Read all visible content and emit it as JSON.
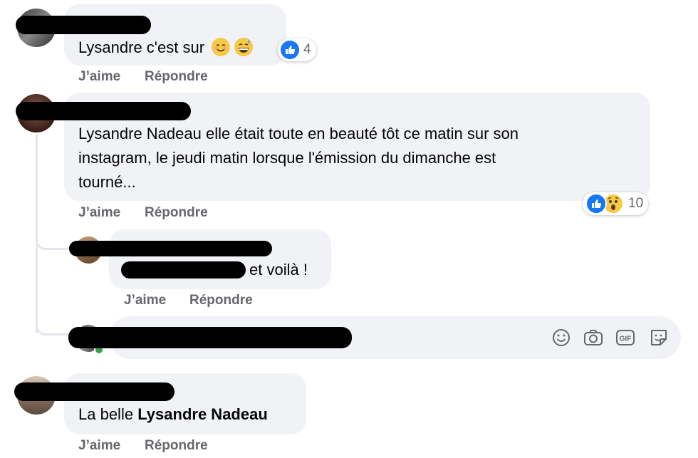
{
  "comments": [
    {
      "text": "Lysandre c'est sur",
      "reaction_count": "4",
      "like_label": "J’aime",
      "reply_label": "Répondre"
    },
    {
      "text_lines": [
        "Lysandre Nadeau elle était toute en beauté tôt ce matin sur son",
        "instagram, le jeudi matin lorsque l'émission du dimanche est",
        "tourné..."
      ],
      "reaction_count": "10",
      "like_label": "J’aime",
      "reply_label": "Répondre"
    },
    {
      "text": "et voilà !",
      "like_label": "J’aime",
      "reply_label": "Répondre"
    },
    {
      "text_prefix": "La belle ",
      "text_bold": "Lysandre Nadeau",
      "like_label": "J’aime",
      "reply_label": "Répondre"
    }
  ],
  "composer": {
    "icons": [
      "emoji-icon",
      "camera-icon",
      "gif-icon",
      "sticker-icon"
    ]
  },
  "colors": {
    "like_blue": "#1877f2",
    "bubble": "#f0f2f5",
    "action_gray": "#65676b"
  }
}
